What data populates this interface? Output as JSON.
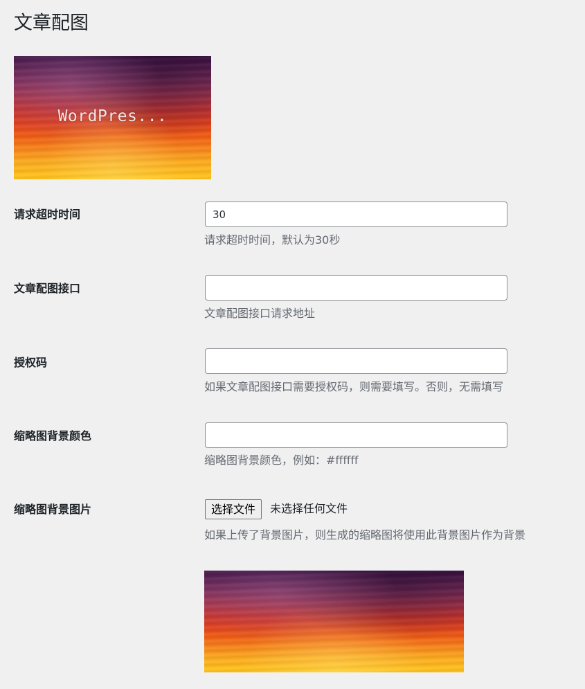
{
  "page": {
    "title": "文章配图",
    "thumbnail_text": "WordPres..."
  },
  "fields": {
    "timeout": {
      "label": "请求超时时间",
      "value": "30",
      "description": "请求超时时间，默认为30秒"
    },
    "api": {
      "label": "文章配图接口",
      "value": "",
      "description": "文章配图接口请求地址"
    },
    "auth": {
      "label": "授权码",
      "value": "",
      "description": "如果文章配图接口需要授权码，则需要填写。否则，无需填写"
    },
    "bg_color": {
      "label": "缩略图背景颜色",
      "value": "",
      "description": "缩略图背景颜色，例如：#ffffff"
    },
    "bg_image": {
      "label": "缩略图背景图片",
      "button_label": "选择文件",
      "status": "未选择任何文件",
      "description": "如果上传了背景图片，则生成的缩略图将使用此背景图片作为背景"
    }
  }
}
